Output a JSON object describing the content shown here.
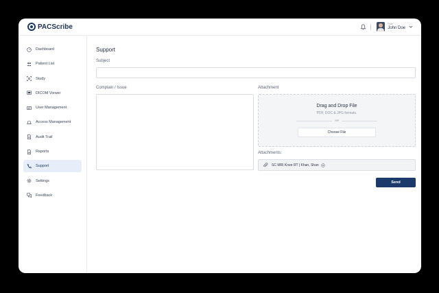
{
  "app": {
    "name": "PACScribe"
  },
  "header": {
    "user_role": "Role",
    "user_name": "John Doe"
  },
  "sidebar": {
    "items": [
      {
        "label": "Dashboard",
        "icon": "dashboard-icon",
        "active": false
      },
      {
        "label": "Patient List",
        "icon": "users-icon",
        "active": false
      },
      {
        "label": "Study",
        "icon": "scan-icon",
        "active": false
      },
      {
        "label": "DICOM Viewer",
        "icon": "monitor-icon",
        "active": false
      },
      {
        "label": "User Management",
        "icon": "id-card-icon",
        "active": false
      },
      {
        "label": "Access Management",
        "icon": "access-icon",
        "active": false
      },
      {
        "label": "Audit Trail",
        "icon": "document-icon",
        "active": false
      },
      {
        "label": "Reports",
        "icon": "report-icon",
        "active": false
      },
      {
        "label": "Support",
        "icon": "phone-icon",
        "active": true
      },
      {
        "label": "Settings",
        "icon": "gear-icon",
        "active": false
      },
      {
        "label": "Feedback",
        "icon": "chat-icon",
        "active": false
      }
    ]
  },
  "main": {
    "title": "Support",
    "subject_label": "Subject",
    "subject_value": "",
    "complain_label": "Complain / Issue",
    "complain_value": "",
    "attachment_label": "Attachment",
    "dropzone": {
      "title": "Drag and Drop File",
      "formats": "PDF, DOC & JPG formats.",
      "or": "OR",
      "choose_label": "Choose File"
    },
    "attachments_label": "Attachments:",
    "attachments": [
      {
        "name": "SC MRI Knee RT | Khan, Shan"
      }
    ],
    "send_label": "Send"
  },
  "colors": {
    "brand": "#1b3a6b",
    "active_bg": "#e8eef9"
  }
}
